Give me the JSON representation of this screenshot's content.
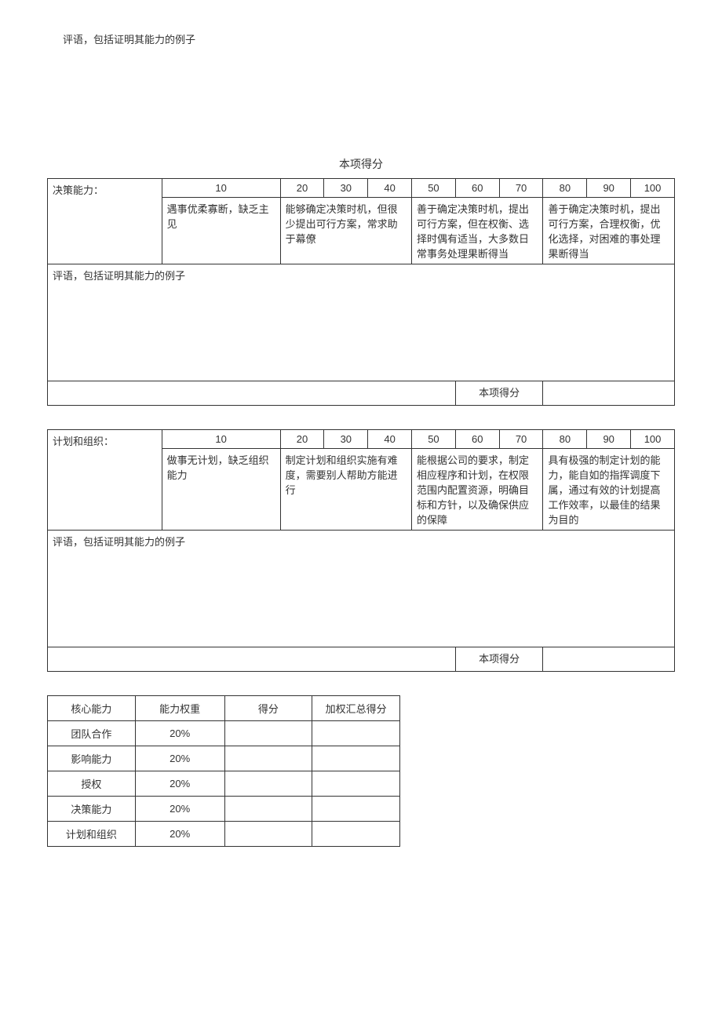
{
  "topComment": "评语，包括证明其能力的例子",
  "scoreHeader": "本项得分",
  "commentLabel": "评语，包括证明其能力的例子",
  "scoreRowLabel": "本项得分",
  "scores": [
    "10",
    "20",
    "30",
    "40",
    "50",
    "60",
    "70",
    "80",
    "90",
    "100"
  ],
  "section1": {
    "title": "决策能力：",
    "levels": [
      "遇事优柔寡断，缺乏主见",
      "能够确定决策时机，但很少提出可行方案，常求助于幕僚",
      "善于确定决策时机，提出可行方案，但在权衡、选择时偶有适当，大多数日常事务处理果断得当",
      "善于确定决策时机，提出可行方案，合理权衡，优化选择，对困难的事处理果断得当"
    ]
  },
  "section2": {
    "title": "计划和组织：",
    "levels": [
      "做事无计划，缺乏组织能力",
      "制定计划和组织实施有难度，需要别人帮助方能进行",
      "能根据公司的要求，制定相应程序和计划，在权限范围内配置资源，明确目标和方针，以及确保供应的保障",
      "具有极强的制定计划的能力，能自如的指挥调度下属，通过有效的计划提高工作效率，以最佳的结果为目的"
    ]
  },
  "summary": {
    "headers": [
      "核心能力",
      "能力权重",
      "得分",
      "加权汇总得分"
    ],
    "rows": [
      {
        "name": "团队合作",
        "weight": "20%",
        "score": "",
        "weighted": ""
      },
      {
        "name": "影响能力",
        "weight": "20%",
        "score": "",
        "weighted": ""
      },
      {
        "name": "授权",
        "weight": "20%",
        "score": "",
        "weighted": ""
      },
      {
        "name": "决策能力",
        "weight": "20%",
        "score": "",
        "weighted": ""
      },
      {
        "name": "计划和组织",
        "weight": "20%",
        "score": "",
        "weighted": ""
      }
    ]
  }
}
